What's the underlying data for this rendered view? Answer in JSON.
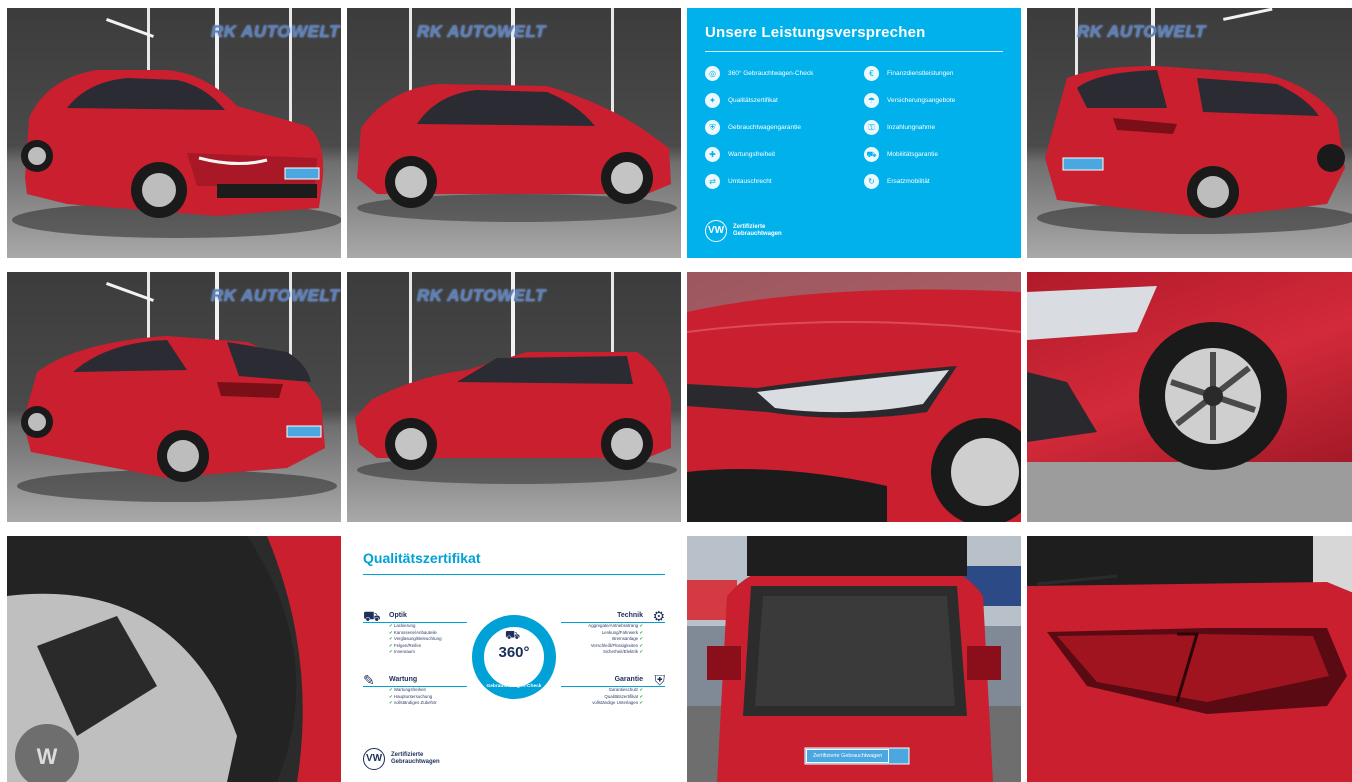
{
  "gallery": {
    "dealer_logo": "RK AUTOWELT",
    "plate_text": "Zertifizierte Gebrauchtwagen",
    "tiles": [
      {
        "kind": "photo",
        "alt": "front-left"
      },
      {
        "kind": "photo",
        "alt": "side-right"
      },
      {
        "kind": "promise"
      },
      {
        "kind": "photo",
        "alt": "rear-right"
      },
      {
        "kind": "photo",
        "alt": "rear-left"
      },
      {
        "kind": "photo",
        "alt": "side-left"
      },
      {
        "kind": "photo",
        "alt": "headlight"
      },
      {
        "kind": "photo",
        "alt": "wheel"
      },
      {
        "kind": "photo",
        "alt": "tire"
      },
      {
        "kind": "certificate"
      },
      {
        "kind": "photo",
        "alt": "trunk"
      },
      {
        "kind": "photo",
        "alt": "taillight"
      }
    ]
  },
  "promise": {
    "title": "Unsere Leistungsversprechen",
    "left_items": [
      "360° Gebrauchtwagen-Check",
      "Qualitätszertifikat",
      "Gebrauchtwagengarantie",
      "Wartungsfreiheit",
      "Umtauschrecht"
    ],
    "right_items": [
      "Finanzdienstleistungen",
      "Versicherungsangebote",
      "Inzahlungnahme",
      "Mobilitätsgarantie",
      "Ersatzmobilität"
    ],
    "footer_line1": "Zertifizierte",
    "footer_line2": "Gebrauchtwagen",
    "badge": "VW"
  },
  "certificate": {
    "title": "Qualitätszertifikat",
    "ring_value": "360°",
    "ring_caption": "Gebrauchtwagen-Check",
    "optik": {
      "head": "Optik",
      "lines": [
        "Lackierung",
        "Karosserie/Anbauteile",
        "Verglasung/Beleuchtung",
        "Felgen/Reifen",
        "Innenraum"
      ]
    },
    "technik": {
      "head": "Technik",
      "lines": [
        "Aggregate/Antriebsstrang",
        "Lenkung/Fahrwerk",
        "Bremsanlage",
        "Verschleiß/Flüssigkeiten",
        "Sicherheit/Elektrik"
      ]
    },
    "wartung": {
      "head": "Wartung",
      "lines": [
        "Wartungsfreiheit",
        "Hauptuntersuchung",
        "vollständiges Zubehör"
      ]
    },
    "garantie": {
      "head": "Garantie",
      "lines": [
        "Garantieschutz",
        "Qualitätszertifikat",
        "vollständige Unterlagen"
      ]
    },
    "footer_line1": "Zertifizierte",
    "footer_line2": "Gebrauchtwagen",
    "badge": "VW"
  },
  "colors": {
    "car_red": "#c91f2f",
    "promise_blue": "#00b1eb",
    "cert_blue": "#00a1d6"
  }
}
